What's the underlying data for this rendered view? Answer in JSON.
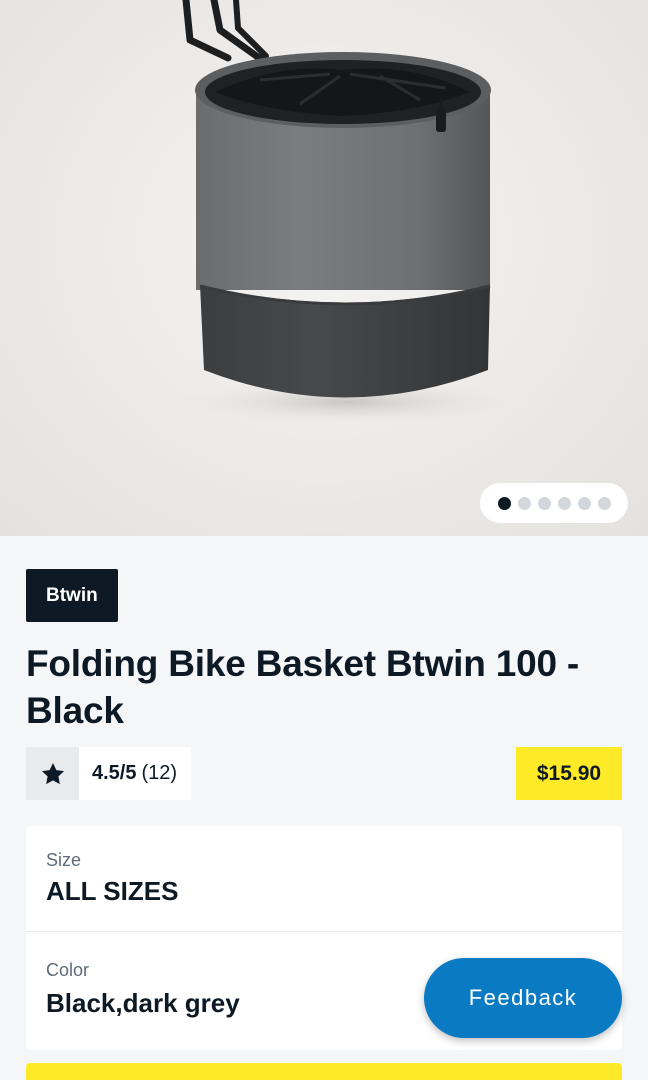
{
  "product_image": {
    "alt": "",
    "carousel": {
      "total": 6,
      "active": 1
    }
  },
  "brand_label": "Btwin",
  "title": "Folding Bike Basket Btwin 100 - Black",
  "rating": {
    "score": "4.5/5",
    "count": "(12)"
  },
  "price": "$15.90",
  "options": {
    "size": {
      "label": "Size",
      "value": "ALL SIZES"
    },
    "color": {
      "label": "Color",
      "value": "Black,dark grey"
    }
  },
  "feedback_label": "Feedback",
  "colors": {
    "brand_dark": "#0d1a26",
    "price_yellow": "#ffea28",
    "feedback_blue": "#0a7bc2"
  },
  "icons": {
    "rating": "star-icon"
  }
}
